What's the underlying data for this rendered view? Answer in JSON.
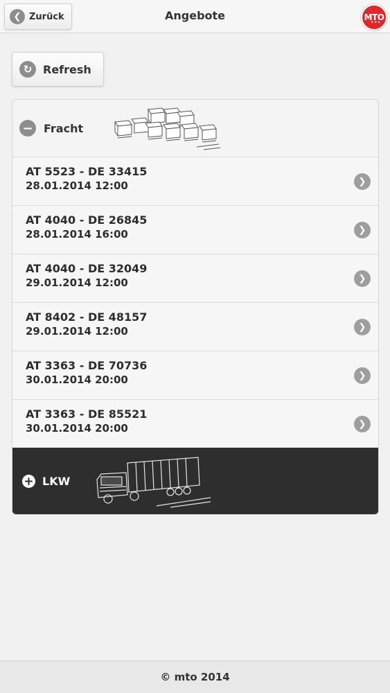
{
  "header": {
    "back_label": "Zurück",
    "title": "Angebote",
    "logo_text": "MTO",
    "logo_dots": "•••"
  },
  "toolbar": {
    "refresh_label": "Refresh"
  },
  "sections": {
    "fracht": {
      "label": "Fracht",
      "expanded": true,
      "items": [
        {
          "route": "AT 5523 - DE 33415",
          "date": "28.01.2014 12:00"
        },
        {
          "route": "AT 4040 - DE 26845",
          "date": "28.01.2014 16:00"
        },
        {
          "route": "AT 4040 - DE 32049",
          "date": "29.01.2014 12:00"
        },
        {
          "route": "AT 8402 - DE 48157",
          "date": "29.01.2014 12:00"
        },
        {
          "route": "AT 3363 - DE 70736",
          "date": "30.01.2014 20:00"
        },
        {
          "route": "AT 3363 - DE 85521",
          "date": "30.01.2014 20:00"
        }
      ]
    },
    "lkw": {
      "label": "LKW",
      "expanded": false
    }
  },
  "footer": {
    "text": "© mto 2014"
  },
  "colors": {
    "accent": "#e3262a",
    "dark_section": "#2e2e2e",
    "icon_gray": "#8d8d8d"
  },
  "icons": {
    "back": "chevron-left-icon",
    "refresh": "refresh-icon",
    "collapse": "minus-circle-icon",
    "expand": "plus-circle-icon",
    "row": "chevron-right-icon"
  }
}
